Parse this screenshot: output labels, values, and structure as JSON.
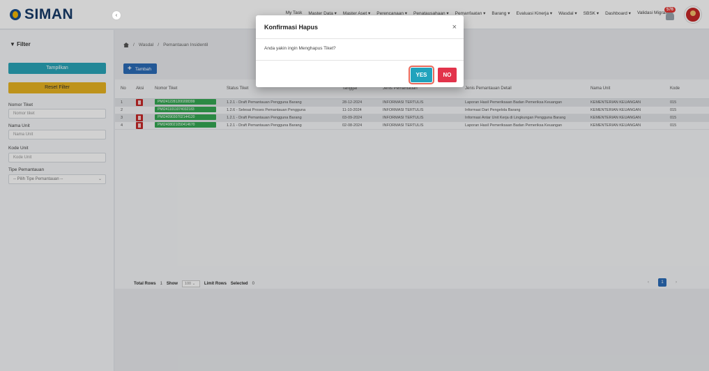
{
  "header": {
    "logo_text": "SIMAN",
    "nav": [
      "My Task",
      "Master Data ▾",
      "Master Aset ▾",
      "Perencanaan ▾",
      "Penatausahaan ▾",
      "Pemanfaatan ▾",
      "Barang ▾",
      "Evaluasi Kinerja ▾",
      "Wasdal ▾",
      "SBSK ▾",
      "Dashboard ▾",
      "Validasi Migrasi"
    ],
    "notif_count": "576"
  },
  "sidebar": {
    "filter_title": "Filter",
    "collapse": "‹",
    "tampilkan_label": "Tampilkan",
    "reset_label": "Reset Filter",
    "nomor_tiket_label": "Nomor Tiket",
    "nomor_tiket_placeholder": "Nomor tiket",
    "nama_unit_label": "Nama Unit",
    "nama_unit_placeholder": "Nama Unit",
    "kode_unit_label": "Kode Unit",
    "kode_unit_placeholder": "Kode Unit",
    "tipe_label": "Tipe Pemantauan",
    "tipe_selected": "-- Pilih Tipe Pemantauan --"
  },
  "breadcrumb": [
    "Wasdal",
    "Pemantauan Insidentil"
  ],
  "toolbar": {
    "add_label": "Tambah"
  },
  "table": {
    "columns": [
      "No",
      "Aksi",
      "Nomor Tiket",
      "Status Tiket",
      "Tanggal",
      "Jenis Pemantauan",
      "Jenis Pemantauan Detail",
      "Nama Unit",
      "Kode"
    ],
    "rows": [
      {
        "no": "1",
        "tiket": "PMI2412281200208399",
        "status": "1.2.1 - Draft Pemantauan Pengguna Barang",
        "tanggal": "28-12-2024",
        "jenis": "INFORMASI TERTULIS",
        "detail": "Laporan Hasil Pemeriksaan Badan Pemeriksa Keuangan",
        "unit": "KEMENTERIAN KEUANGAN",
        "kode": "015",
        "has_delete": true
      },
      {
        "no": "2",
        "tiket": "PMI2411011074032183",
        "status": "1.2.6 - Selesai Proses Pemantauan Pengguna",
        "tanggal": "11-10-2024",
        "jenis": "INFORMASI TERTULIS",
        "detail": "Informasi Dari Pengelola Barang",
        "unit": "KEMENTERIAN KEUANGAN",
        "kode": "015",
        "has_delete": false
      },
      {
        "no": "3",
        "tiket": "PMI2409030702144120",
        "status": "1.2.1 - Draft Pemantauan Pengguna Barang",
        "tanggal": "03-09-2024",
        "jenis": "INFORMASI TERTULIS",
        "detail": "Informasi Antar Unit Kerja di Lingkungan Pengguna Barang",
        "unit": "KEMENTERIAN KEUANGAN",
        "kode": "015",
        "has_delete": true
      },
      {
        "no": "4",
        "tiket": "PMI2408021050414670",
        "status": "1.2.1 - Draft Pemantauan Pengguna Barang",
        "tanggal": "02-08-2024",
        "jenis": "INFORMASI TERTULIS",
        "detail": "Laporan Hasil Pemeriksaan Badan Pemeriksa Keuangan",
        "unit": "KEMENTERIAN KEUANGAN",
        "kode": "015",
        "has_delete": true
      }
    ]
  },
  "footer": {
    "total_label": "Total Rows",
    "total_value": "1",
    "show_label": "Show",
    "show_value": "100",
    "limit_label": "Limit Rows",
    "selected_label": "Selected",
    "selected_value": "0",
    "prev": "‹",
    "page": "1",
    "next": "›"
  },
  "modal": {
    "title": "Konfirmasi Hapus",
    "close": "×",
    "message": "Anda yakin ingin Menghapus Tiket?",
    "yes_label": "YES",
    "no_label": "NO"
  }
}
